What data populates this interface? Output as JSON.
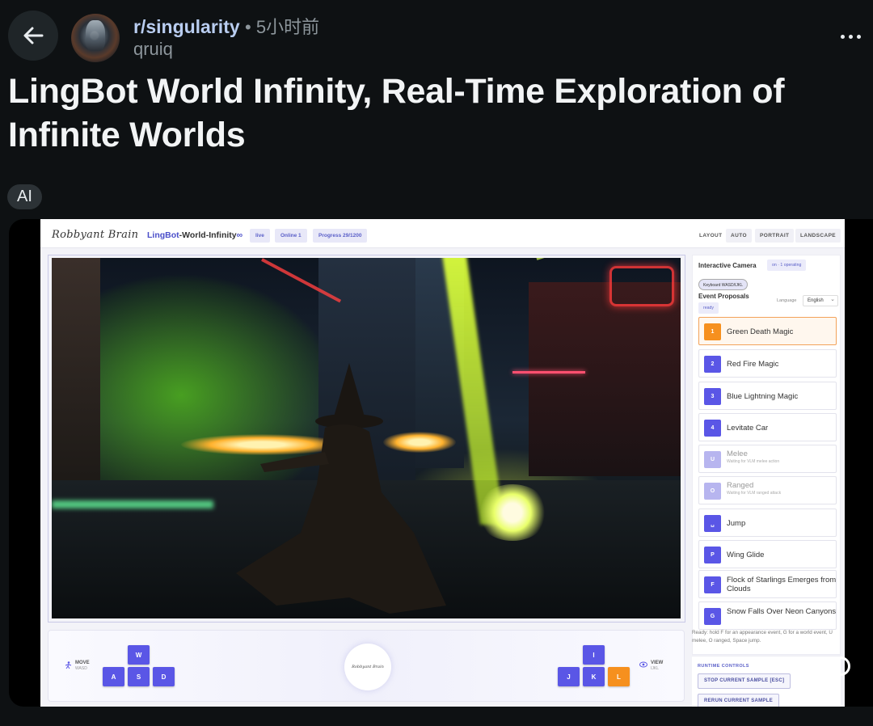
{
  "post": {
    "subreddit": "r/singularity",
    "separator": "•",
    "time": "5小时前",
    "author": "qruiq",
    "title": "LingBot World Infinity, Real-Time Exploration of Infinite Worlds",
    "flair": "AI"
  },
  "app": {
    "brand": "Robbyant Brain",
    "name_prefix": "LingBot",
    "name_suffix": "-World-Infinity",
    "name_icon": "∞",
    "chips": [
      "live",
      "Online 1",
      "Progress 29/1200"
    ],
    "layout_label": "LAYOUT",
    "layout_options": [
      "AUTO",
      "PORTRAIT",
      "LANDSCAPE"
    ],
    "controls": {
      "move_label": "MOVE",
      "move_sub": "WASD",
      "move_keys": [
        "W",
        "A",
        "S",
        "D"
      ],
      "view_label": "VIEW",
      "view_sub": "IJKL",
      "view_keys": [
        "I",
        "J",
        "K",
        "L"
      ],
      "active_view_key": "L",
      "center_logo": "Robbyant Brain"
    },
    "panel": {
      "camera_title": "Interactive Camera",
      "camera_status": "on · 1 operating",
      "keyboard_chip": "Keyboard WASD/IJKL",
      "events_title": "Event Proposals",
      "events_status": "ready",
      "language_label": "Language",
      "language_value": "English",
      "events": [
        {
          "key": "1",
          "label": "Green Death Magic",
          "state": "selected"
        },
        {
          "key": "2",
          "label": "Red Fire Magic",
          "state": "normal"
        },
        {
          "key": "3",
          "label": "Blue Lightning Magic",
          "state": "normal"
        },
        {
          "key": "4",
          "label": "Levitate Car",
          "state": "normal"
        },
        {
          "key": "U",
          "label": "Melee",
          "sub": "Waiting for VLM melee action",
          "state": "disabled"
        },
        {
          "key": "O",
          "label": "Ranged",
          "sub": "Waiting for VLM ranged attack",
          "state": "disabled"
        },
        {
          "key": "␣",
          "label": "Jump",
          "state": "normal"
        },
        {
          "key": "P",
          "label": "Wing Glide",
          "state": "normal"
        },
        {
          "key": "F",
          "label": "Flock of Starlings Emerges from Clouds",
          "state": "normal"
        },
        {
          "key": "G",
          "label": "Snow Falls Over Neon Canyons",
          "state": "normal"
        }
      ],
      "ready_text": "Ready: hold F for an appearance event, G for a world event, U melee, O ranged, Space jump.",
      "runtime_title": "RUNTIME CONTROLS",
      "stop_button": "STOP CURRENT SAMPLE [ESC]",
      "rerun_button": "RERUN CURRENT SAMPLE"
    }
  },
  "colors": {
    "accent": "#5a56e6",
    "active_key": "#f6901e",
    "subreddit": "#b9cdf0"
  }
}
